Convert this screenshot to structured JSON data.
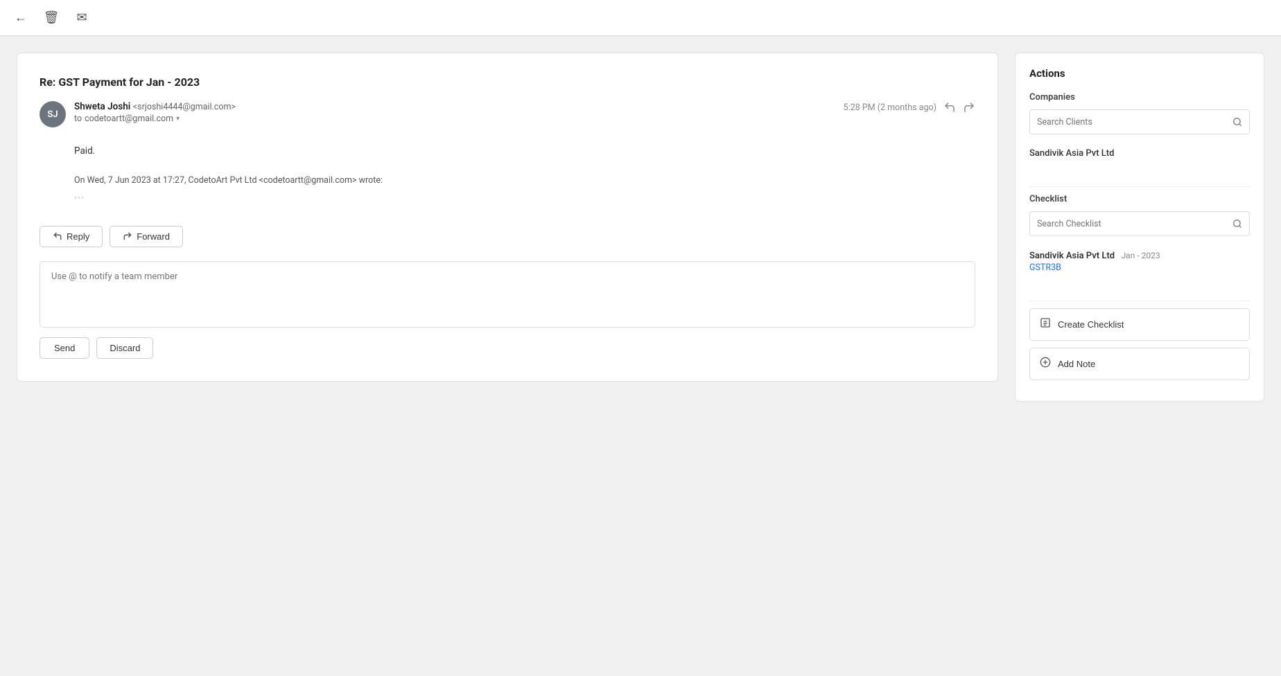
{
  "toolbar": {
    "back_icon": "←",
    "delete_icon": "🗑",
    "archive_icon": "✉"
  },
  "email": {
    "subject": "Re: GST Payment for Jan - 2023",
    "sender": {
      "initials": "SJ",
      "name": "Shweta Joshi",
      "email": "<srjoshi4444@gmail.com>",
      "to_label": "to",
      "to_address": "codetoartt@gmail.com"
    },
    "timestamp": "5:28 PM (2 months ago)",
    "body_line1": "Paid.",
    "quoted_text": "On Wed, 7 Jun 2023 at 17:27, CodetoArt Pvt Ltd <codetoartt@gmail.com> wrote:",
    "ellipsis": "···",
    "reply_btn": "Reply",
    "forward_btn": "Forward",
    "reply_placeholder": "Use @ to notify a team member",
    "send_btn": "Send",
    "discard_btn": "Discard"
  },
  "sidebar": {
    "title": "Actions",
    "companies": {
      "label": "Companies",
      "search_placeholder": "Search Clients",
      "items": [
        {
          "name": "Sandivik Asia Pvt Ltd"
        }
      ]
    },
    "checklist": {
      "label": "Checklist",
      "search_placeholder": "Search Checklist",
      "items": [
        {
          "company": "Sandivik Asia Pvt Ltd",
          "date": "Jan - 2023",
          "tag": "GSTR3B"
        }
      ]
    },
    "create_checklist_btn": "Create Checklist",
    "add_note_btn": "Add Note"
  }
}
